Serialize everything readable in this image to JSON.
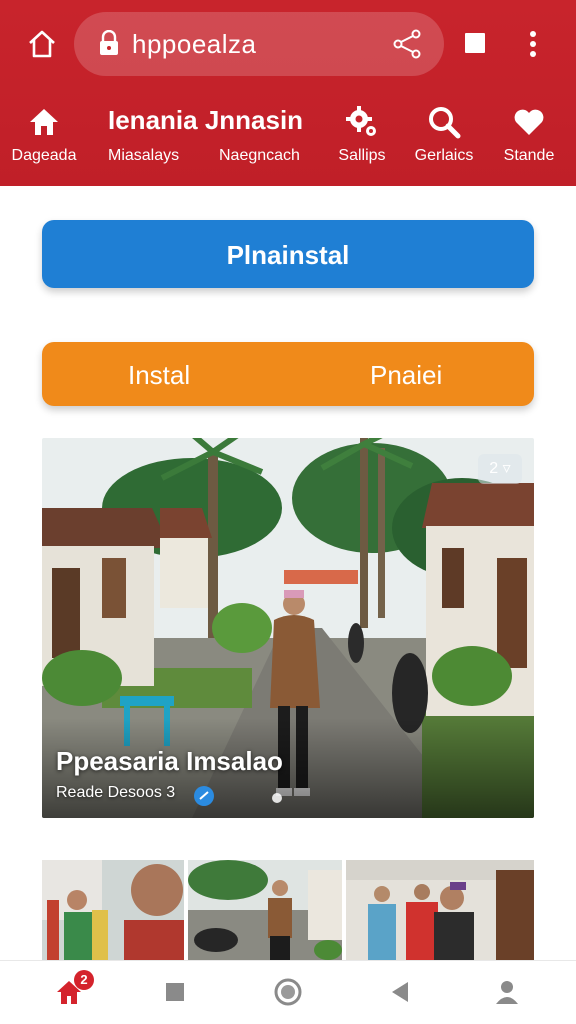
{
  "browser": {
    "url": "hppoealza"
  },
  "header": {
    "title": "Ienania Jnnasin",
    "nav": [
      {
        "label": "Dageada",
        "icon": "home-icon"
      },
      {
        "label": "Miasalays",
        "icon": ""
      },
      {
        "label": "Naegncach",
        "icon": ""
      },
      {
        "label": "Sallips",
        "icon": "gear-icon"
      },
      {
        "label": "Gerlaics",
        "icon": "search-icon"
      },
      {
        "label": "Stande",
        "icon": "heart-icon"
      }
    ]
  },
  "buttons": {
    "primary": "Plnainstal",
    "secondary_left": "Instal",
    "secondary_right": "Pnaiei"
  },
  "hero": {
    "title": "Ppeasaria Imsalao",
    "subtitle": "Reade Desoos 3",
    "badge": "2"
  },
  "bottom_nav": {
    "notification_count": "2"
  },
  "colors": {
    "header": "#c8242c",
    "primary_button": "#1f7fd4",
    "secondary_button": "#f08a1a",
    "active_nav": "#d4232c"
  }
}
